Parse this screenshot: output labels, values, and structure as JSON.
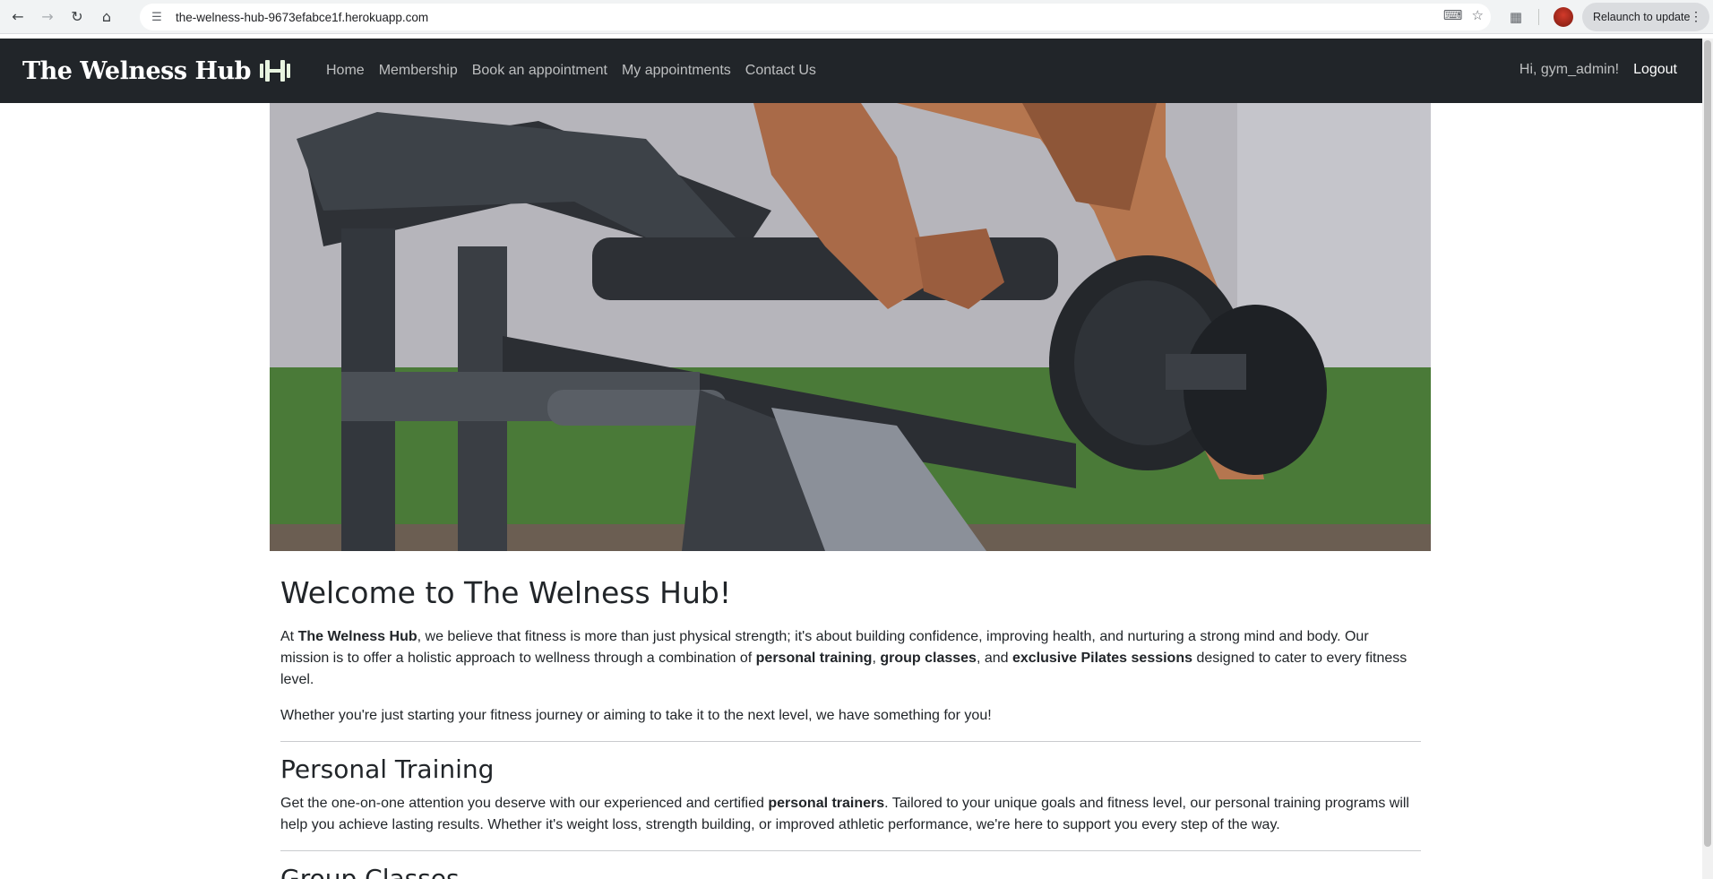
{
  "browser": {
    "url": "the-welness-hub-9673efabce1f.herokuapp.com",
    "relaunch_label": "Relaunch to update"
  },
  "nav": {
    "brand": "The Welness Hub",
    "links": [
      "Home",
      "Membership",
      "Book an appointment",
      "My appointments",
      "Contact Us"
    ],
    "greeting": "Hi, gym_admin!",
    "logout": "Logout"
  },
  "welcome": {
    "title": "Welcome to The Welness Hub!",
    "p1": {
      "t1": "At ",
      "b1": "The Welness Hub",
      "t2": ", we believe that fitness is more than just physical strength; it's about building confidence, improving health, and nurturing a strong mind and body. Our mission is to offer a holistic approach to wellness through a combination of ",
      "b2": "personal training",
      "t3": ", ",
      "b3": "group classes",
      "t4": ", and ",
      "b4": "exclusive Pilates sessions",
      "t5": " designed to cater to every fitness level."
    },
    "p2": "Whether you're just starting your fitness journey or aiming to take it to the next level, we have something for you!"
  },
  "personal_training": {
    "title": "Personal Training",
    "t1": "Get the one-on-one attention you deserve with our experienced and certified ",
    "b1": "personal trainers",
    "t2": ". Tailored to your unique goals and fitness level, our personal training programs will help you achieve lasting results. Whether it's weight loss, strength building, or improved athletic performance, we're here to support you every step of the way."
  },
  "group_classes": {
    "title": "Group Classes"
  },
  "colors": {
    "navbar": "#212529",
    "text": "#212529"
  }
}
